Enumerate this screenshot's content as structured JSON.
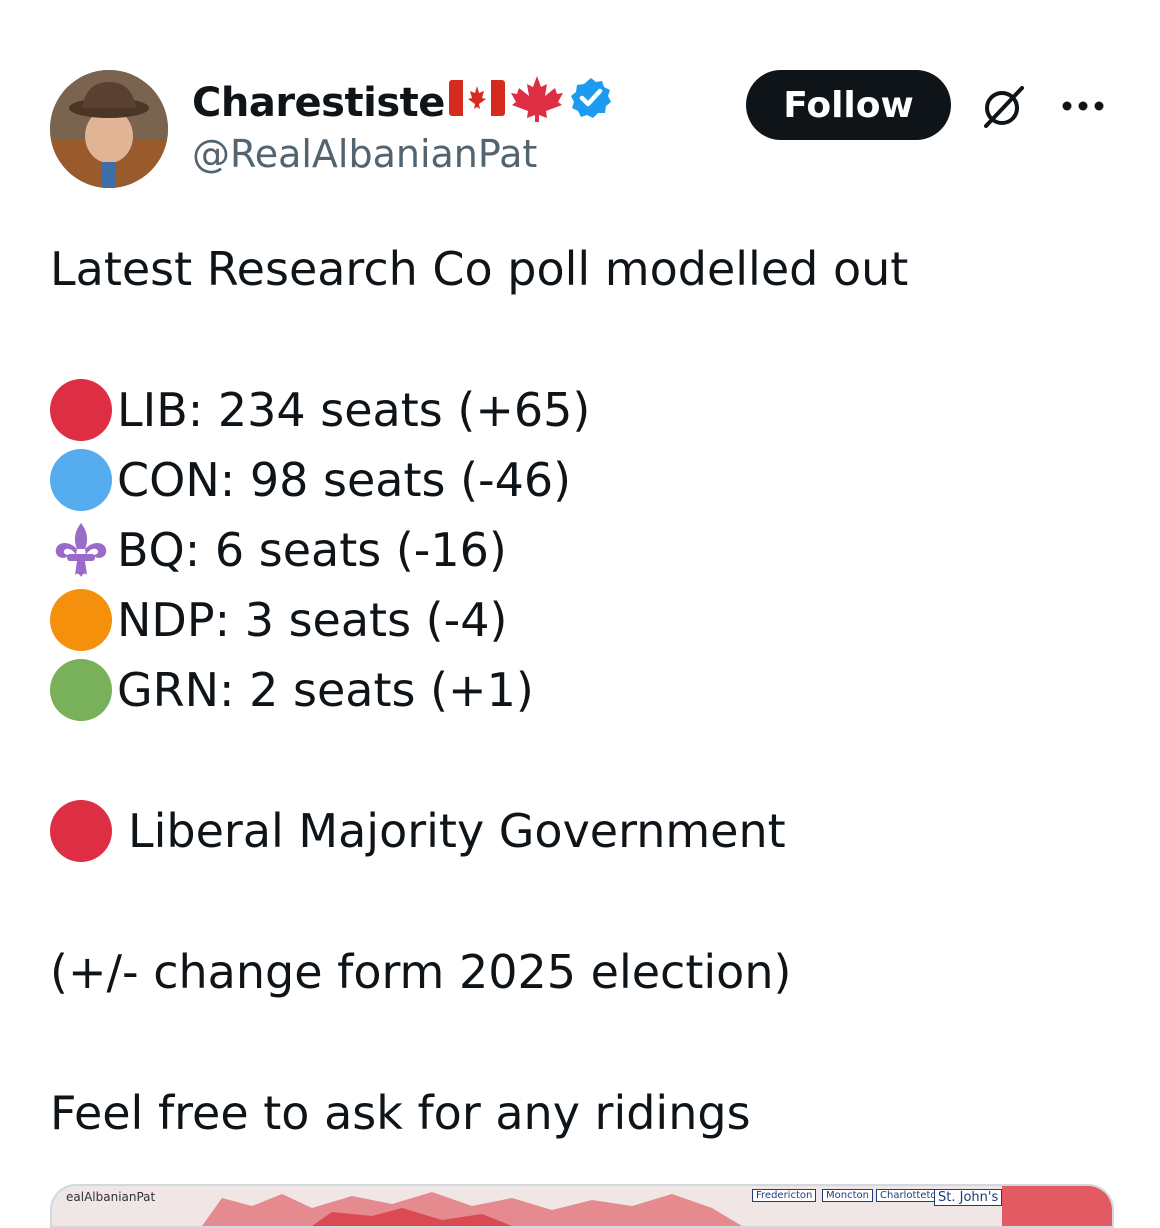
{
  "author": {
    "display_name": "Charestiste",
    "handle": "@RealAlbanianPat",
    "badges": [
      "canada-flag-icon",
      "maple-leaf-icon",
      "verified-icon"
    ]
  },
  "header": {
    "follow_label": "Follow",
    "grok_icon": "grok-icon",
    "more_icon": "more-icon"
  },
  "tweet": {
    "intro": "Latest Research Co poll modelled out",
    "results": [
      {
        "marker": "red-circle",
        "color": "#dd2e44",
        "text": "LIB: 234 seats (+65)"
      },
      {
        "marker": "blue-circle",
        "color": "#55acee",
        "text": "CON: 98 seats (-46)"
      },
      {
        "marker": "fleur-de-lis",
        "color": "#9b6bc9",
        "text": "BQ: 6 seats (-16)"
      },
      {
        "marker": "orange-circle",
        "color": "#f4900c",
        "text": "NDP: 3 seats (-4)"
      },
      {
        "marker": "green-circle",
        "color": "#78b159",
        "text": "GRN: 2 seats (+1)"
      }
    ],
    "majority": {
      "marker": "red-circle",
      "color": "#dd2e44",
      "text": "Liberal Majority Government"
    },
    "note": "(+/- change form 2025 election)",
    "closing": "Feel free to ask for any ridings"
  },
  "media": {
    "watermark": "ealAlbanianPat",
    "labels": [
      "Fredericton",
      "Moncton",
      "Charlottetown",
      "St. John's"
    ]
  },
  "colors": {
    "text": "#0f1419",
    "secondary": "#536471",
    "verified": "#1d9bf0",
    "follow_bg": "#0f1419"
  }
}
